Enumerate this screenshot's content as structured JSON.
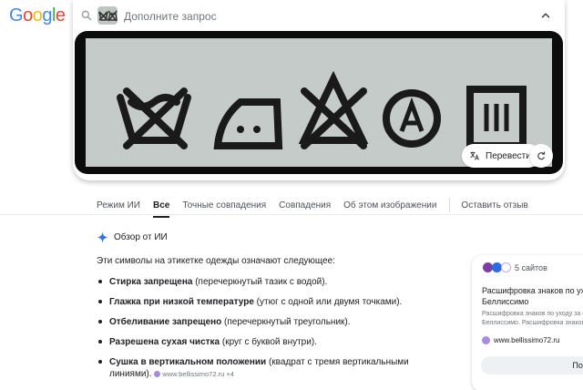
{
  "brand": {
    "letters": [
      "G",
      "o",
      "o",
      "g",
      "l",
      "e"
    ],
    "colors": [
      "#4285F4",
      "#EA4335",
      "#FBBC05",
      "#4285F4",
      "#34A853",
      "#EA4335"
    ]
  },
  "search": {
    "placeholder": "Дополните запрос",
    "icon": "search-icon",
    "collapse_icon": "chevron-up-icon"
  },
  "image_panel": {
    "translate_label": "Перевести",
    "translate_icon": "translate-icon",
    "refresh_icon": "rotate-icon"
  },
  "tabs": [
    {
      "label": "Режим ИИ",
      "active": false
    },
    {
      "label": "Все",
      "active": true
    },
    {
      "label": "Точные совпадения",
      "active": false
    },
    {
      "label": "Совпадения",
      "active": false
    },
    {
      "label": "Об этом изображении",
      "active": false
    },
    {
      "label": "Оставить отзыв",
      "active": false
    }
  ],
  "ai_overview": {
    "title": "Обзор от ИИ",
    "intro": "Эти символы на этикетке одежды означают следующее:",
    "items": [
      {
        "bold": "Стирка запрещена",
        "rest": " (перечеркнутый тазик с водой)."
      },
      {
        "bold": "Глажка при низкой температуре",
        "rest": " (утюг с одной или двумя точками)."
      },
      {
        "bold": "Отбеливание запрещено",
        "rest": " (перечеркнутый треугольник)."
      },
      {
        "bold": "Разрешена сухая чистка",
        "rest": " (круг с буквой внутри)."
      },
      {
        "bold": "Сушка в вертикальном положении",
        "rest": " (квадрат с тремя вертикальными линиями).",
        "source": "www.bellissimo72.ru +4"
      }
    ]
  },
  "side_card": {
    "sites_count": "5 сайтов",
    "title_line1": "Расшифровка знаков по ух",
    "title_line2": "Беллиссимо",
    "snippet_line1": "Расшифровка знаков по уходу за одежд",
    "snippet_line2": "Беллиссимо. Расшифровка знаков по",
    "source": "www.bellissimo72.ru",
    "button_label": "Пока"
  }
}
